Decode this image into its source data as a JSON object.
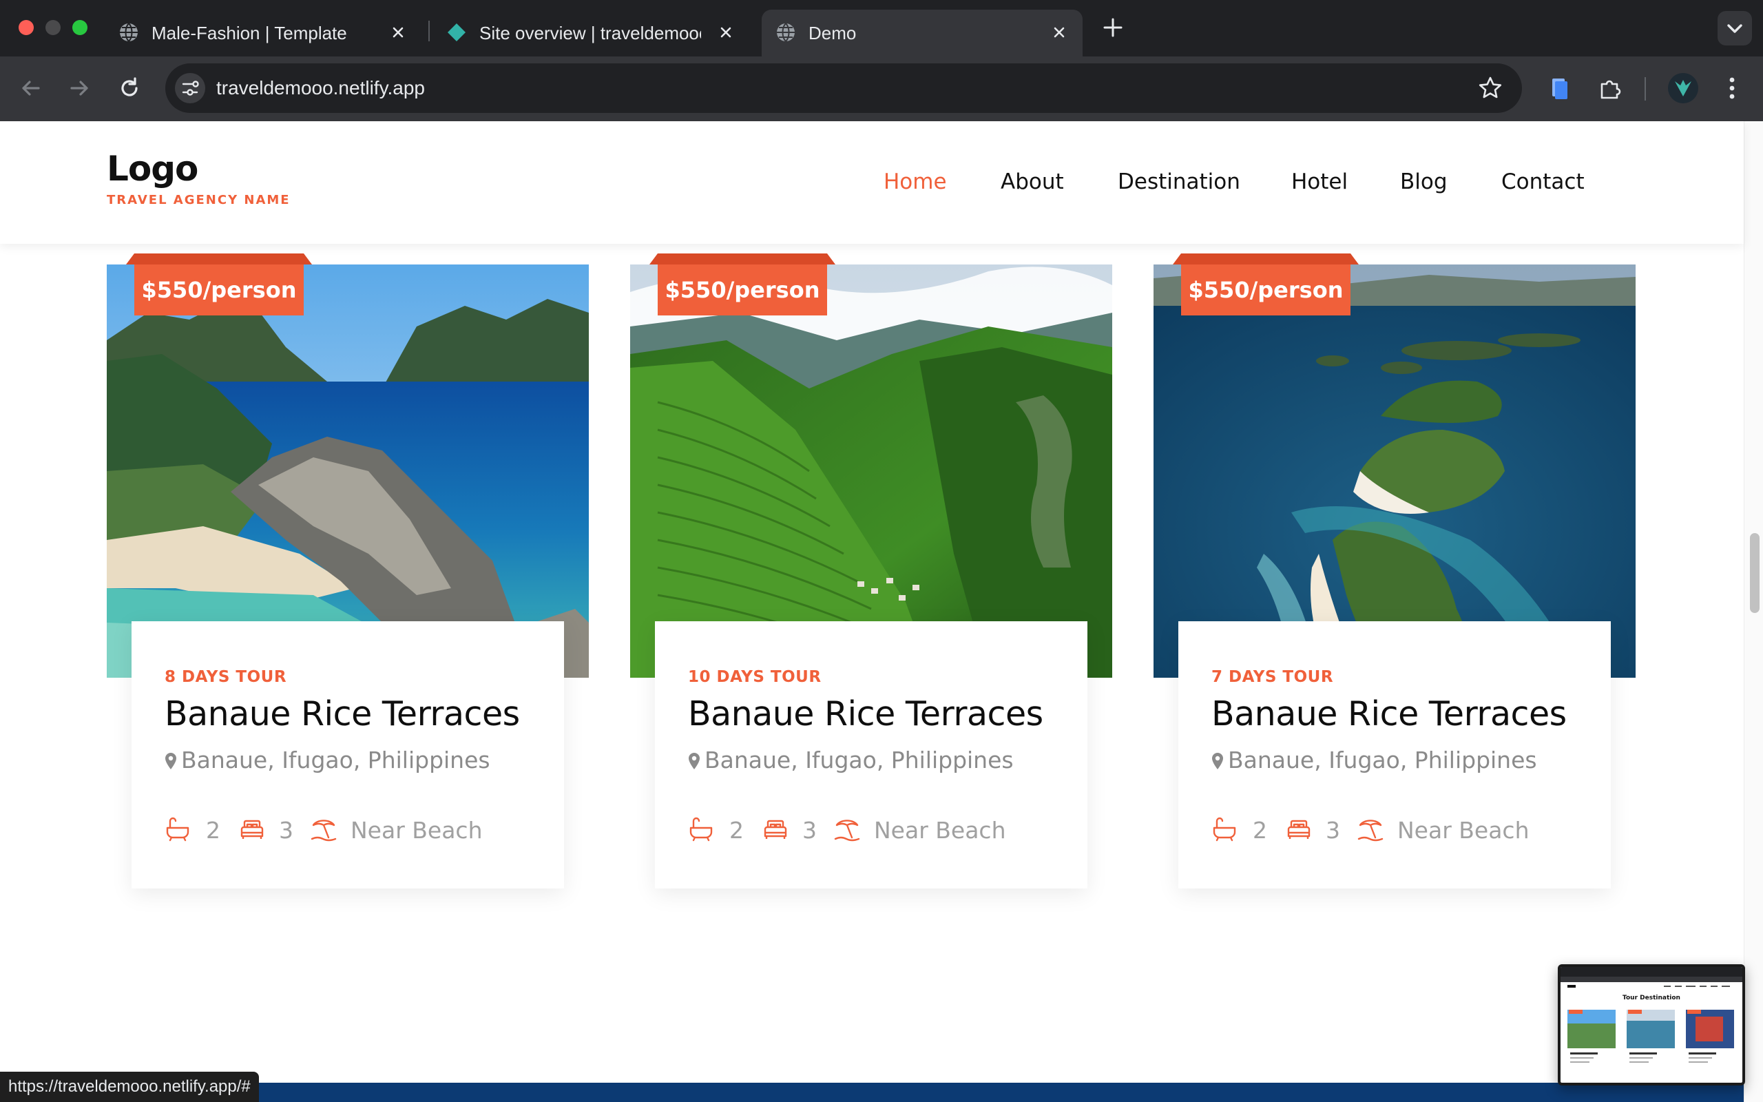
{
  "browser": {
    "tabs": [
      {
        "title": "Male-Fashion | Template",
        "active": false
      },
      {
        "title": "Site overview | traveldemooo",
        "active": false
      },
      {
        "title": "Demo",
        "active": true
      }
    ],
    "address": "traveldemooo.netlify.app",
    "status_url": "https://traveldemooo.netlify.app/#"
  },
  "site": {
    "logo": "Logo",
    "tagline": "TRAVEL AGENCY NAME",
    "nav": [
      {
        "label": "Home",
        "active": true
      },
      {
        "label": "About",
        "active": false
      },
      {
        "label": "Destination",
        "active": false
      },
      {
        "label": "Hotel",
        "active": false
      },
      {
        "label": "Blog",
        "active": false
      },
      {
        "label": "Contact",
        "active": false
      }
    ]
  },
  "cards": [
    {
      "price": "$550/person",
      "days": "8 DAYS TOUR",
      "title": "Banaue Rice Terraces",
      "location": "Banaue, Ifugao, Philippines",
      "baths": "2",
      "beds": "3",
      "feature": "Near Beach"
    },
    {
      "price": "$550/person",
      "days": "10 DAYS TOUR",
      "title": "Banaue Rice Terraces",
      "location": "Banaue, Ifugao, Philippines",
      "baths": "2",
      "beds": "3",
      "feature": "Near Beach"
    },
    {
      "price": "$550/person",
      "days": "7 DAYS TOUR",
      "title": "Banaue Rice Terraces",
      "location": "Banaue, Ifugao, Philippines",
      "baths": "2",
      "beds": "3",
      "feature": "Near Beach"
    }
  ],
  "pip": {
    "title": "Tour Destination"
  },
  "colors": {
    "accent": "#f0603a",
    "chrome_dark": "#202124",
    "chrome_toolbar": "#35363a"
  },
  "icons": [
    "globe-icon",
    "netlify-icon",
    "close-icon",
    "plus-icon",
    "chevron-down-icon",
    "back-icon",
    "forward-icon",
    "reload-icon",
    "tune-icon",
    "star-icon",
    "extension-icon",
    "puzzle-icon",
    "profile-avatar",
    "more-icon",
    "location-pin-icon",
    "bathtub-icon",
    "bed-icon",
    "beach-umbrella-icon"
  ]
}
